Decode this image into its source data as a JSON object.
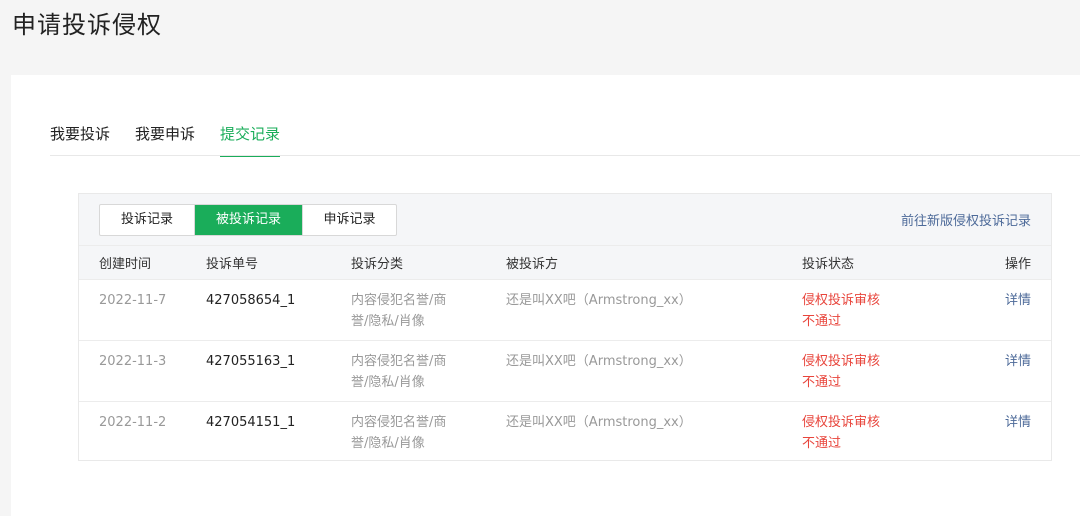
{
  "page": {
    "title": "申请投诉侵权"
  },
  "main_tabs": [
    {
      "label": "我要投诉",
      "active": false
    },
    {
      "label": "我要申诉",
      "active": false
    },
    {
      "label": "提交记录",
      "active": true
    }
  ],
  "sub_tabs": [
    {
      "label": "投诉记录",
      "active": false
    },
    {
      "label": "被投诉记录",
      "active": true
    },
    {
      "label": "申诉记录",
      "active": false
    }
  ],
  "new_version_link": "前往新版侵权投诉记录",
  "table": {
    "headers": [
      "创建时间",
      "投诉单号",
      "投诉分类",
      "被投诉方",
      "投诉状态",
      "操作"
    ],
    "rows": [
      {
        "date": "2022-11-7",
        "id": "427058654_1",
        "category": "内容侵犯名誉/商誉/隐私/肖像",
        "party": "还是叫XX吧（Armstrong_xx）",
        "status": "侵权投诉审核不通过",
        "action": "详情"
      },
      {
        "date": "2022-11-3",
        "id": "427055163_1",
        "category": "内容侵犯名誉/商誉/隐私/肖像",
        "party": "还是叫XX吧（Armstrong_xx）",
        "status": "侵权投诉审核不通过",
        "action": "详情"
      },
      {
        "date": "2022-11-2",
        "id": "427054151_1",
        "category": "内容侵犯名誉/商誉/隐私/肖像",
        "party": "还是叫XX吧（Armstrong_xx）",
        "status": "侵权投诉审核不通过",
        "action": "详情"
      }
    ]
  },
  "colors": {
    "accent": "#1aad5a",
    "status_error": "#e8453c",
    "link": "#4d6a99"
  }
}
